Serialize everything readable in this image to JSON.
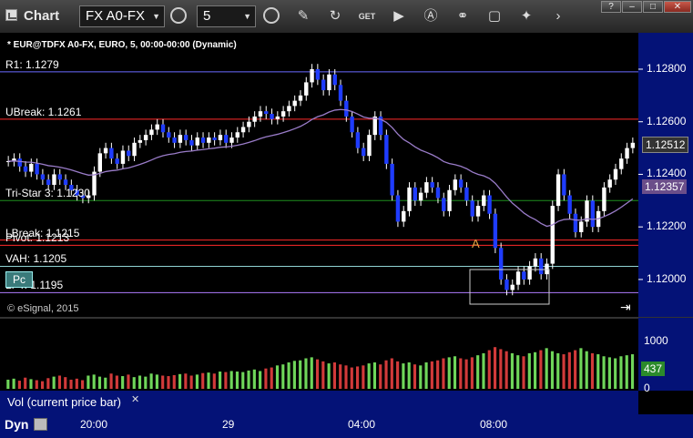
{
  "toolbar": {
    "app_title": "Chart",
    "symbol": "FX A0-FX",
    "interval": "5"
  },
  "chart": {
    "title": "* EUR@TDFX A0-FX, EURO, 5, 00:00-00:00 (Dynamic)",
    "copyright": "© eSignal, 2015",
    "levels": [
      {
        "label": "R1: 1.1279",
        "price": 1.1279,
        "color": "#6a6aff"
      },
      {
        "label": "UBreak: 1.1261",
        "price": 1.1261,
        "color": "#ff2a2a"
      },
      {
        "label": "Tri-Star 3: 1.1230",
        "price": 1.123,
        "color": "#1f8f1f"
      },
      {
        "label": "LBreak: 1.1215",
        "price": 1.1215,
        "color": "#ff2a2a"
      },
      {
        "label": "Pivot: 1.1213",
        "price": 1.1213,
        "color": "#ff2a2a"
      },
      {
        "label": "VAH: 1.1205",
        "price": 1.1205,
        "color": "#8fd3d3"
      },
      {
        "label": "LPT: 1.1195",
        "price": 1.1195,
        "color": "#b17bff"
      }
    ],
    "price_axis": [
      "1.12800",
      "1.12600",
      "1.12400",
      "1.12200",
      "1.12000"
    ],
    "last_price": "1.12512",
    "ma_price": "1.12357",
    "marker_a": "A",
    "pc_label": "Pc",
    "time_axis": [
      "20:00",
      "29",
      "04:00",
      "08:00"
    ]
  },
  "volume": {
    "axis": [
      "1000",
      "0"
    ],
    "last": "437",
    "legend": "Vol (current price bar)"
  },
  "bottom": {
    "label": "Dyn"
  },
  "chart_data": {
    "type": "candlestick",
    "title": "* EUR@TDFX A0-FX, EURO, 5, 00:00-00:00 (Dynamic)",
    "ylim": [
      1.1192,
      1.1289
    ],
    "closes": [
      1.1245,
      1.1246,
      1.1243,
      1.1241,
      1.1244,
      1.124,
      1.1238,
      1.1236,
      1.124,
      1.1238,
      1.1236,
      1.1234,
      1.1232,
      1.1231,
      1.1232,
      1.1241,
      1.1248,
      1.125,
      1.1246,
      1.1244,
      1.1249,
      1.1247,
      1.1252,
      1.1253,
      1.1255,
      1.1257,
      1.1259,
      1.1256,
      1.1254,
      1.1252,
      1.1255,
      1.1253,
      1.1251,
      1.1254,
      1.1252,
      1.1254,
      1.1253,
      1.1255,
      1.1252,
      1.1254,
      1.1256,
      1.1258,
      1.126,
      1.1262,
      1.1264,
      1.1263,
      1.1261,
      1.1262,
      1.1264,
      1.1266,
      1.1268,
      1.127,
      1.1275,
      1.128,
      1.1276,
      1.1272,
      1.1278,
      1.1274,
      1.1268,
      1.1262,
      1.1256,
      1.125,
      1.1247,
      1.1255,
      1.1262,
      1.1255,
      1.1244,
      1.1232,
      1.1222,
      1.1226,
      1.1235,
      1.123,
      1.1233,
      1.1237,
      1.1235,
      1.1231,
      1.1226,
      1.1234,
      1.1238,
      1.1235,
      1.123,
      1.1224,
      1.1228,
      1.1232,
      1.1225,
      1.1212,
      1.12,
      1.1196,
      1.1198,
      1.1203,
      1.12,
      1.1205,
      1.1208,
      1.1202,
      1.1206,
      1.1228,
      1.124,
      1.1232,
      1.1225,
      1.1218,
      1.1222,
      1.123,
      1.122,
      1.1226,
      1.1235,
      1.1238,
      1.1242,
      1.1246,
      1.125,
      1.1252
    ],
    "volume": [
      180,
      200,
      160,
      220,
      190,
      170,
      150,
      210,
      240,
      260,
      230,
      180,
      200,
      170,
      260,
      280,
      240,
      220,
      300,
      260,
      250,
      280,
      230,
      260,
      240,
      300,
      280,
      260,
      250,
      270,
      290,
      300,
      260,
      280,
      310,
      320,
      300,
      340,
      330,
      350,
      340,
      330,
      360,
      380,
      350,
      400,
      420,
      460,
      480,
      520,
      550,
      560,
      600,
      620,
      580,
      540,
      500,
      520,
      480,
      460,
      420,
      440,
      460,
      500,
      520,
      480,
      560,
      600,
      540,
      500,
      520,
      480,
      460,
      520,
      540,
      560,
      600,
      620,
      640,
      600,
      580,
      620,
      660,
      700,
      760,
      820,
      780,
      740,
      700,
      660,
      640,
      700,
      720,
      760,
      800,
      740,
      700,
      680,
      720,
      760,
      800,
      740,
      700,
      680,
      640,
      620,
      600,
      640,
      660,
      680
    ]
  }
}
